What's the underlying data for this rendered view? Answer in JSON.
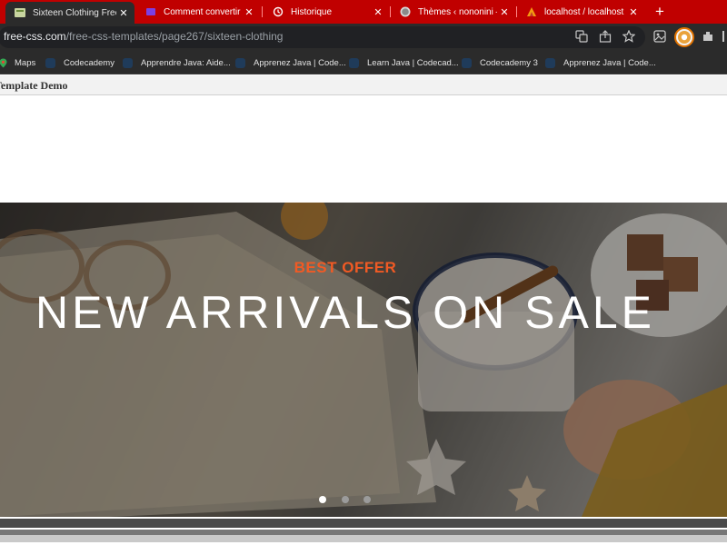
{
  "browser": {
    "tabs": [
      {
        "title": "Sixteen Clothing Free",
        "icon": "template-tab-icon",
        "active": true
      },
      {
        "title": "Comment convertir H",
        "icon": "twitch-tab-icon",
        "active": false
      },
      {
        "title": "Historique",
        "icon": "history-icon",
        "active": false
      },
      {
        "title": "Thèmes ‹ nononini —",
        "icon": "wordpress-icon",
        "active": false
      },
      {
        "title": "localhost / localhost /",
        "icon": "phpmyadmin-icon",
        "active": false
      }
    ],
    "new_tab_symbol": "+",
    "close_symbol": "✕",
    "url_host": "free-css.com",
    "url_path": "/free-css-templates/page267/sixteen-clothing",
    "colors": {
      "tabstrip": "#c00000",
      "toolbar": "#2b2b2b",
      "accent_orange": "#f15a24"
    }
  },
  "bookmarks": [
    {
      "label": "Maps"
    },
    {
      "label": "Codecademy"
    },
    {
      "label": "Apprendre Java: Aide..."
    },
    {
      "label": "Apprenez Java | Code..."
    },
    {
      "label": "Learn Java | Codecad..."
    },
    {
      "label": "Codecademy 3"
    },
    {
      "label": "Apprenez Java | Code..."
    }
  ],
  "page": {
    "demo_title": "Template Demo",
    "hero": {
      "label": "BEST OFFER",
      "title": "NEW ARRIVALS ON SALE",
      "slide_count": 3,
      "active_slide": 1
    }
  }
}
